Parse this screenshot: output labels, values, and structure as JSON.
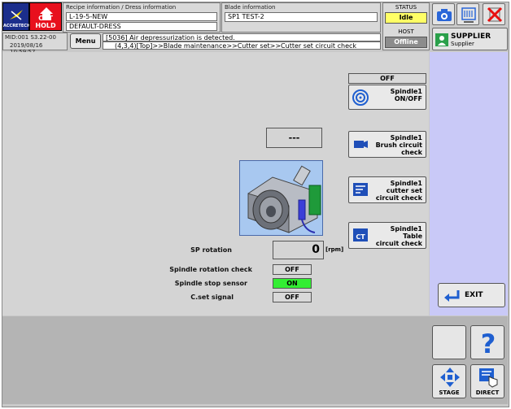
{
  "header": {
    "brand": "ACCRETECH",
    "cut_hold": "CUT HOLD",
    "recipe_label": "Recipe information / Dress information",
    "recipe_name": "L-19-5-NEW",
    "dress_name": "DEFAULT-DRESS",
    "blade_label": "Blade information",
    "blade_value": "SP1  TEST-2",
    "machine_id": "MID:001  S3.22-00",
    "datetime": "2019/08/16 10:59:57",
    "menu_label": "Menu",
    "message": "[5036] Air depressurization is detected.",
    "breadcrumb": "(4,3,4)[Top]>>Blade maintenance>>Cutter set>>Cutter set circuit check",
    "status_label": "STATUS",
    "status_value": "Idle",
    "host_label": "HOST",
    "host_value": "Offline",
    "supplier_title": "SUPPLIER",
    "supplier_sub": "Supplier"
  },
  "main": {
    "onoff_state": "OFF",
    "btn_spindle_onoff": [
      "Spindle1",
      "ON/OFF"
    ],
    "btn_brush": [
      "Spindle1",
      "Brush circuit",
      "check"
    ],
    "btn_cutter_set": [
      "Spindle1",
      "cutter set",
      "circuit check"
    ],
    "btn_table": [
      "Spindle1",
      "Table",
      "circuit check"
    ],
    "dash_value": "---",
    "sp_rotation_label": "SP rotation",
    "sp_rotation_value": "0",
    "sp_rotation_unit": "[rpm]",
    "rot_check_label": "Spindle rotation check",
    "rot_check_value": "OFF",
    "stop_sensor_label": "Spindle stop sensor",
    "stop_sensor_value": "ON",
    "cset_label": "C.set signal",
    "cset_value": "OFF"
  },
  "side": {
    "exit_label": "EXIT"
  },
  "bottom": {
    "stage_label": "STAGE",
    "direct_label": "DIRECT"
  },
  "colors": {
    "side_panel": "#c9c9f7",
    "on_green": "#33ee33",
    "idle_yellow": "#ffff66",
    "cut_hold_red": "#e8101d"
  }
}
